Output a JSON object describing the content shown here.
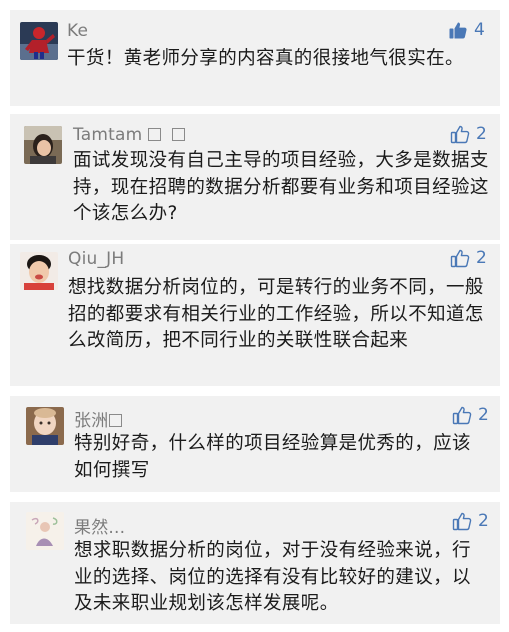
{
  "comments": [
    {
      "name": "Ke",
      "likes": "4",
      "liked": true,
      "avatar_icon": "superhero-avatar-icon",
      "text": "干货！黄老师分享的内容真的很接地气很实在。"
    },
    {
      "name": "Tamtam",
      "likes": "2",
      "liked": false,
      "avatar_icon": "girl-photo-avatar-icon",
      "text": "面试发现没有自己主导的项目经验，大多是数据支持，现在招聘的数据分析都要有业务和项目经验这个该怎么办?"
    },
    {
      "name": "Qiu_JH",
      "likes": "2",
      "liked": false,
      "avatar_icon": "child-photo-avatar-icon",
      "text": "想找数据分析岗位的，可是转行的业务不同，一般招的都要求有相关行业的工作经验，所以不知道怎么改简历，把不同行业的关联性联合起来"
    },
    {
      "name": "张洲",
      "likes": "2",
      "liked": false,
      "avatar_icon": "baby-photo-avatar-icon",
      "text": "特别好奇，什么样的项目经验算是优秀的，应该如何撰写"
    },
    {
      "name": "果然...",
      "likes": "2",
      "liked": false,
      "avatar_icon": "illustration-avatar-icon",
      "text": "想求职数据分析的岗位，对于没有经验来说，行业的选择、岗位的选择有没有比较好的建议，以及未来职业规划该怎样发展呢。"
    }
  ],
  "colors": {
    "card_bg": "#f1f1f1",
    "like_blue": "#4a78b6",
    "name_gray": "#7c7c7c"
  }
}
